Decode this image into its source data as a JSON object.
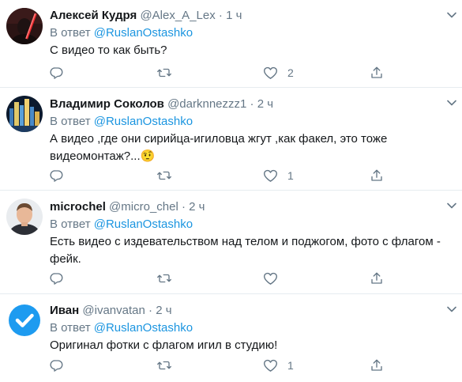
{
  "reply_prefix": "В ответ",
  "reply_mention": "@RuslanOstashko",
  "tweets": [
    {
      "name": "Алексей Кудря",
      "handle": "@Alex_A_Lex",
      "dot": "·",
      "time": "1 ч",
      "text": "С видео то как быть?",
      "like_count": "2",
      "retweet_count": "",
      "reply_count": ""
    },
    {
      "name": "Владимир Соколов",
      "handle": "@darknnezzz1",
      "dot": "·",
      "time": "2 ч",
      "text": "А видео ,где они сирийца-игиловца  жгут ,как факел, это тоже видеомонтаж?...🤨",
      "like_count": "1",
      "retweet_count": "",
      "reply_count": ""
    },
    {
      "name": "microchel",
      "handle": "@micro_chel",
      "dot": "·",
      "time": "2 ч",
      "text": "Есть видео с издевательством над телом и поджогом, фото с флагом - фейк.",
      "like_count": "",
      "retweet_count": "",
      "reply_count": ""
    },
    {
      "name": "Иван",
      "handle": "@ivanvatan",
      "dot": "·",
      "time": "2 ч",
      "text": "Оригинал фотки с флагом игил в студию!",
      "like_count": "1",
      "retweet_count": "",
      "reply_count": ""
    }
  ],
  "colors": {
    "accent": "#1b95e0",
    "secondary_text": "#657786",
    "primary_text": "#14171a",
    "divider": "#e6ecf0"
  },
  "icons": [
    "reply-icon",
    "retweet-icon",
    "like-icon",
    "share-icon",
    "caret-down-icon"
  ]
}
